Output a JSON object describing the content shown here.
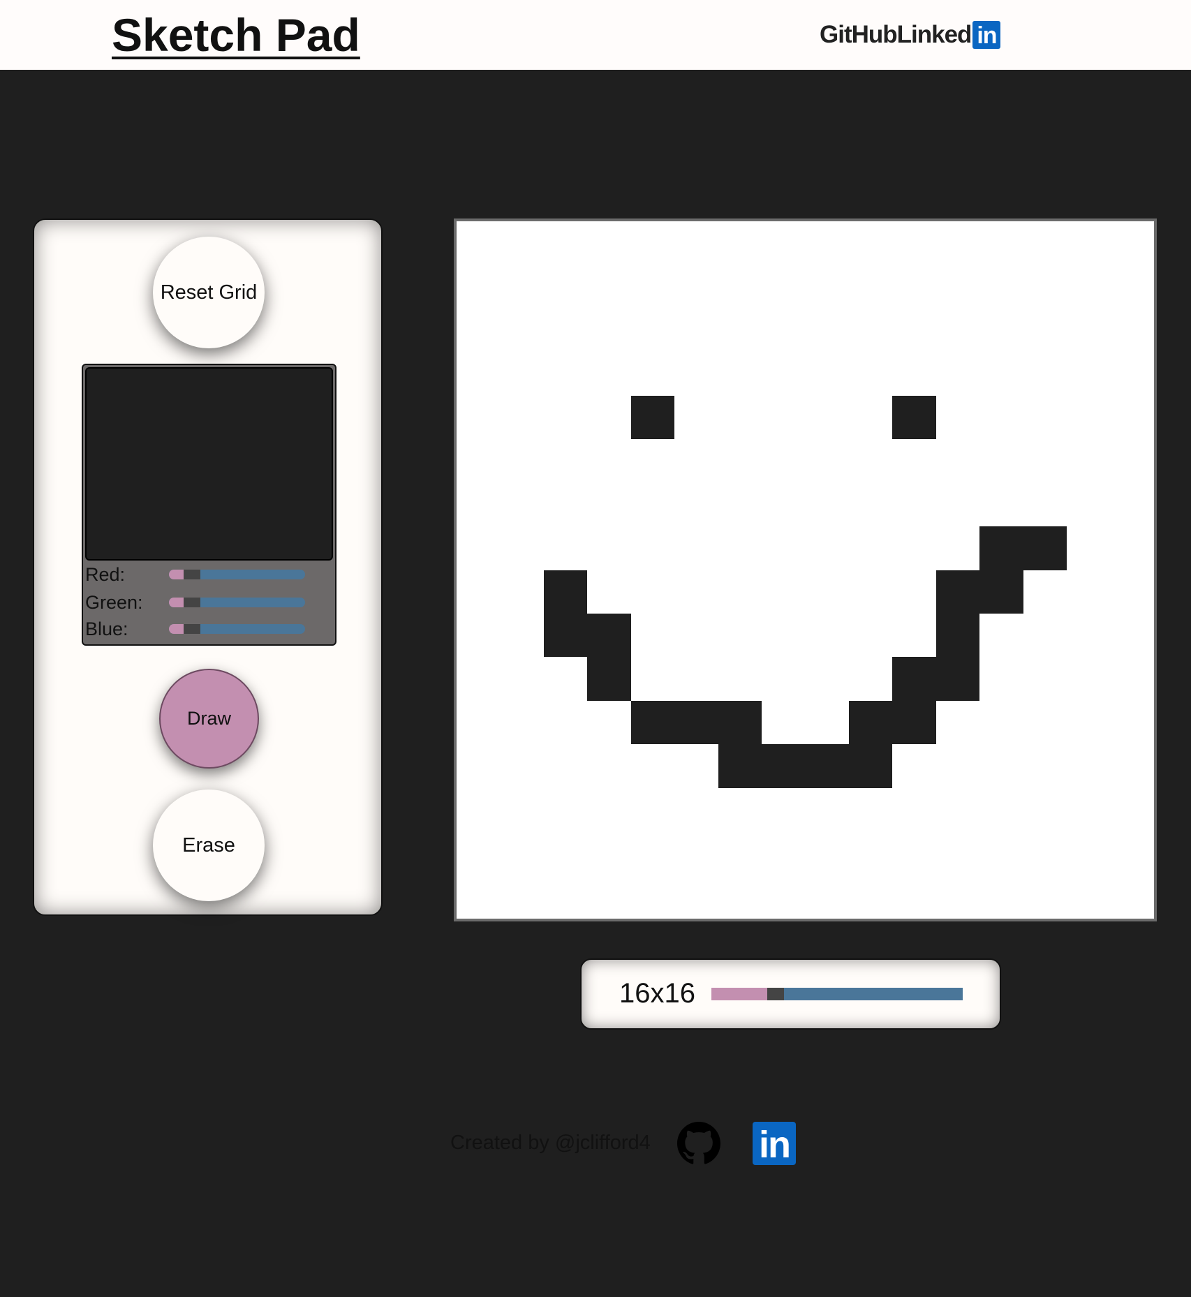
{
  "header": {
    "title": "Sketch Pad",
    "github_label": "GitHub",
    "linkedin_label": "Linked",
    "linkedin_badge": "in"
  },
  "controls": {
    "reset_label": "Reset Grid",
    "draw_label": "Draw",
    "erase_label": "Erase",
    "preview_color": "#1f1f1f",
    "sliders": [
      {
        "label": "Red:",
        "value": 31,
        "max": 255
      },
      {
        "label": "Green:",
        "value": 31,
        "max": 255
      },
      {
        "label": "Blue:",
        "value": 31,
        "max": 255
      }
    ]
  },
  "grid": {
    "size": 16,
    "filled_color": "#1f1f1f",
    "empty_color": "#ffffff",
    "filled_cells": [
      [
        4,
        4
      ],
      [
        4,
        10
      ],
      [
        7,
        12
      ],
      [
        7,
        13
      ],
      [
        8,
        2
      ],
      [
        8,
        11
      ],
      [
        8,
        12
      ],
      [
        9,
        2
      ],
      [
        9,
        3
      ],
      [
        9,
        11
      ],
      [
        10,
        3
      ],
      [
        10,
        10
      ],
      [
        10,
        11
      ],
      [
        11,
        4
      ],
      [
        11,
        5
      ],
      [
        11,
        6
      ],
      [
        11,
        9
      ],
      [
        11,
        10
      ],
      [
        12,
        6
      ],
      [
        12,
        7
      ],
      [
        12,
        8
      ],
      [
        12,
        9
      ]
    ]
  },
  "size_control": {
    "label": "16x16",
    "value": 16,
    "min": 1,
    "max": 64
  },
  "footer": {
    "credit": "Created by @jclifford4",
    "linkedin_badge": "in"
  },
  "colors": {
    "background": "#1f1f1f",
    "panel": "#fffcf9",
    "accent_pink": "#c38fb0",
    "accent_blue": "#4a7699",
    "linkedin_blue": "#0a66c2"
  }
}
